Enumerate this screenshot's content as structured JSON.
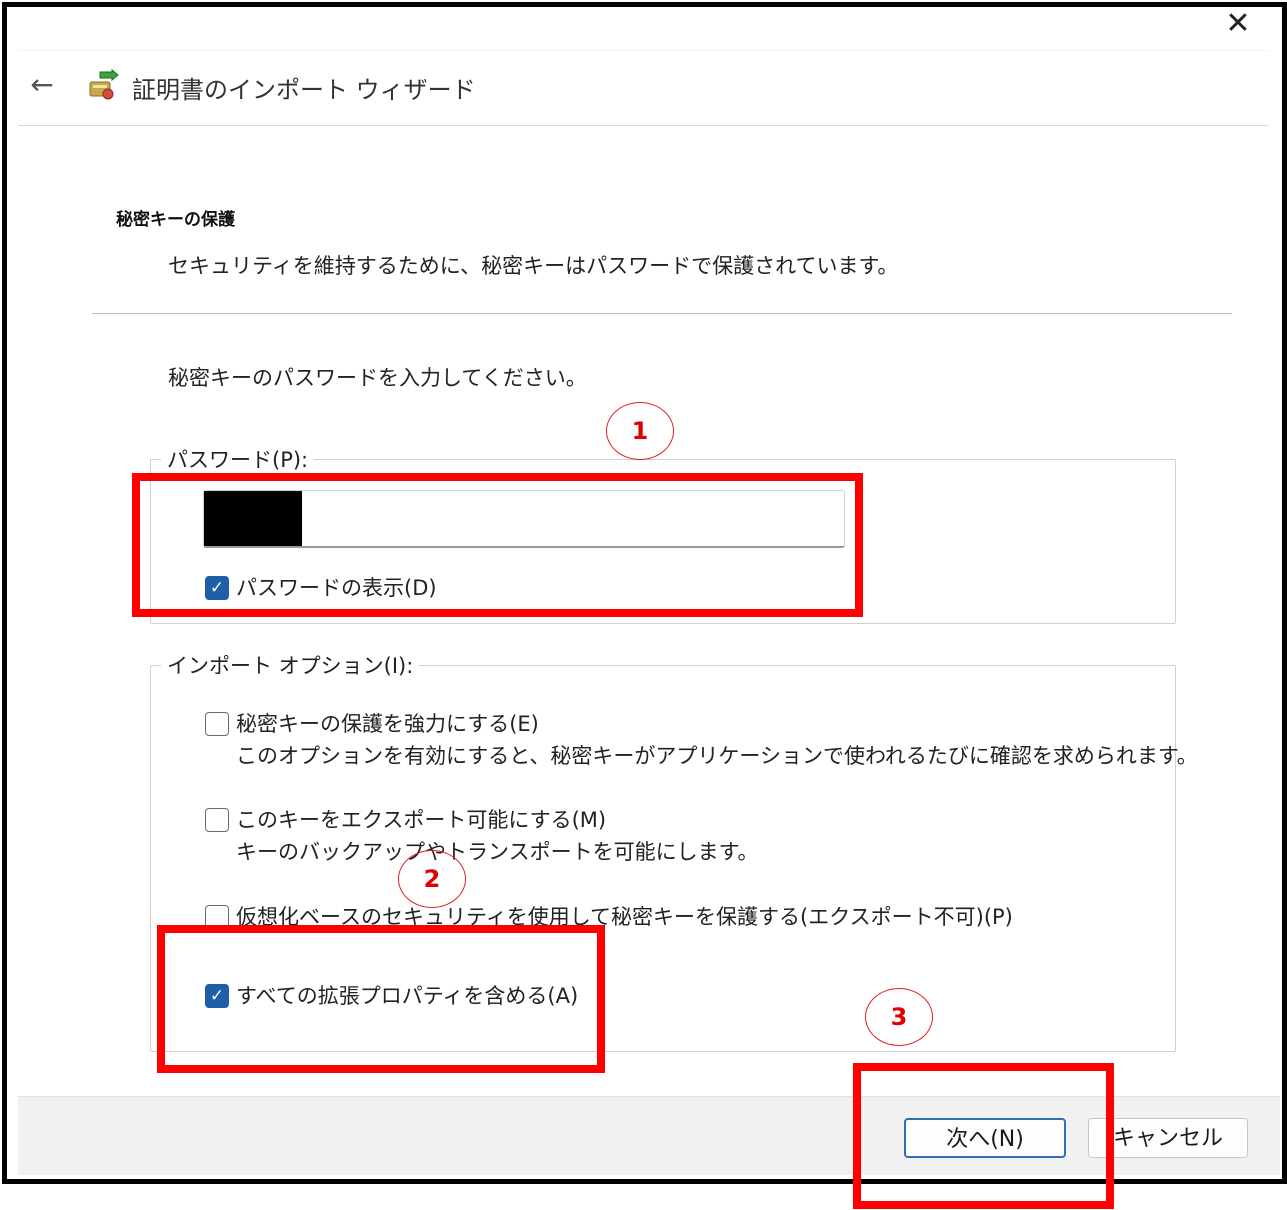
{
  "window": {
    "title": "証明書のインポート ウィザード",
    "close_glyph": "✕",
    "back_glyph": "←"
  },
  "header": {
    "section_title": "秘密キーの保護",
    "section_desc": "セキュリティを維持するために、秘密キーはパスワードで保護されています。"
  },
  "instruction": "秘密キーのパスワードを入力してください。",
  "password_group": {
    "legend": "パスワード(P):",
    "value_redacted": true,
    "show_password": {
      "label": "パスワードの表示(D)",
      "checked": true
    }
  },
  "options_group": {
    "legend": "インポート オプション(I):",
    "items": [
      {
        "label": "秘密キーの保護を強力にする(E)",
        "desc": "このオプションを有効にすると、秘密キーがアプリケーションで使われるたびに確認を求められます。",
        "checked": false
      },
      {
        "label": "このキーをエクスポート可能にする(M)",
        "desc": "キーのバックアップやトランスポートを可能にします。",
        "checked": false
      },
      {
        "label": "仮想化ベースのセキュリティを使用して秘密キーを保護する(エクスポート不可)(P)",
        "desc": "",
        "checked": false
      },
      {
        "label": "すべての拡張プロパティを含める(A)",
        "desc": "",
        "checked": true
      }
    ]
  },
  "footer": {
    "next_label": "次へ(N)",
    "cancel_label": "キャンセル"
  },
  "annotations": {
    "markers": [
      "1",
      "2",
      "3"
    ],
    "color": "#ff0000"
  },
  "colors": {
    "checkbox_checked": "#1f5fa8",
    "primary_button_border": "#2f6fb5"
  }
}
